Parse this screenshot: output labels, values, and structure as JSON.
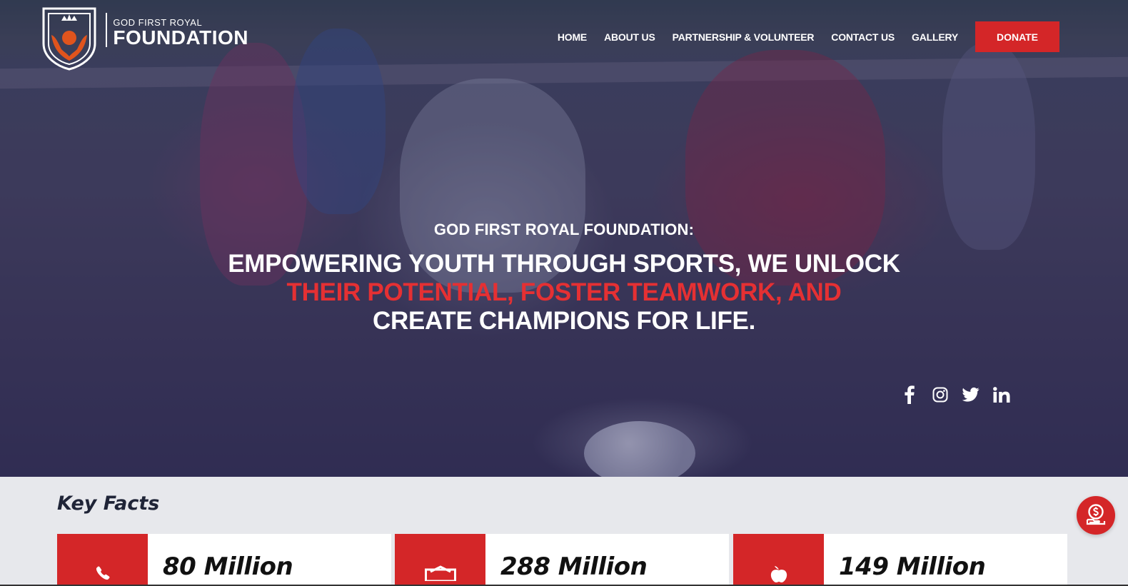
{
  "brand": {
    "small": "GOD FIRST ROYAL",
    "big": "FOUNDATION"
  },
  "nav": {
    "items": [
      {
        "label": "HOME"
      },
      {
        "label": "ABOUT US"
      },
      {
        "label": "PARTNERSHIP & VOLUNTEER"
      },
      {
        "label": "CONTACT US"
      },
      {
        "label": "GALLERY"
      }
    ],
    "donate_label": "DONATE"
  },
  "hero": {
    "kicker": "GOD FIRST ROYAL FOUNDATION:",
    "line1": "EMPOWERING YOUTH THROUGH SPORTS, WE UNLOCK",
    "line2": "THEIR POTENTIAL, FOSTER TEAMWORK, AND",
    "line3": "CREATE CHAMPIONS FOR LIFE.",
    "socials": [
      "facebook-icon",
      "instagram-icon",
      "twitter-icon",
      "linkedin-icon"
    ]
  },
  "facts": {
    "title": "Key Facts",
    "cards": [
      {
        "value": "80 Million",
        "icon": "phone-icon"
      },
      {
        "value": "288 Million",
        "icon": "house-icon"
      },
      {
        "value": "149 Million",
        "icon": "apple-icon"
      }
    ]
  },
  "colors": {
    "accent": "#d42628",
    "hero_highlight": "#e53033",
    "facts_bg": "#e7e8ec"
  },
  "float_button": {
    "icon": "donate-hand-icon"
  }
}
